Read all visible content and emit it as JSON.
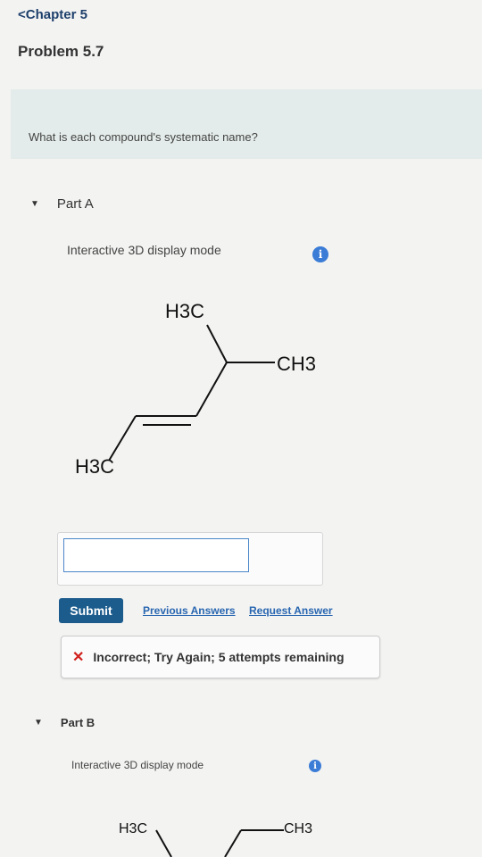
{
  "nav": {
    "back_label": "Chapter 5"
  },
  "problem": {
    "title": "Problem 5.7"
  },
  "question": {
    "text": "What is each compound's systematic name?"
  },
  "part_a": {
    "title": "Part A",
    "mode_label": "Interactive 3D display mode",
    "info_icon": "info-icon",
    "molecule": {
      "top_label": "H3C",
      "right_label": "CH3",
      "bottom_label": "H3C"
    },
    "answer_value": "",
    "submit_label": "Submit",
    "previous_answers_label": "Previous Answers",
    "request_answer_label": "Request Answer",
    "feedback": "Incorrect; Try Again; 5 attempts remaining"
  },
  "part_b": {
    "title": "Part B",
    "mode_label": "Interactive 3D display mode",
    "molecule": {
      "left_label": "H3C",
      "right_label": "CH3"
    }
  },
  "colors": {
    "accent": "#1c5c8d",
    "link": "#2866b0",
    "error": "#d0201d",
    "info": "#3b7cd6",
    "question_bg": "#e3ecea"
  }
}
